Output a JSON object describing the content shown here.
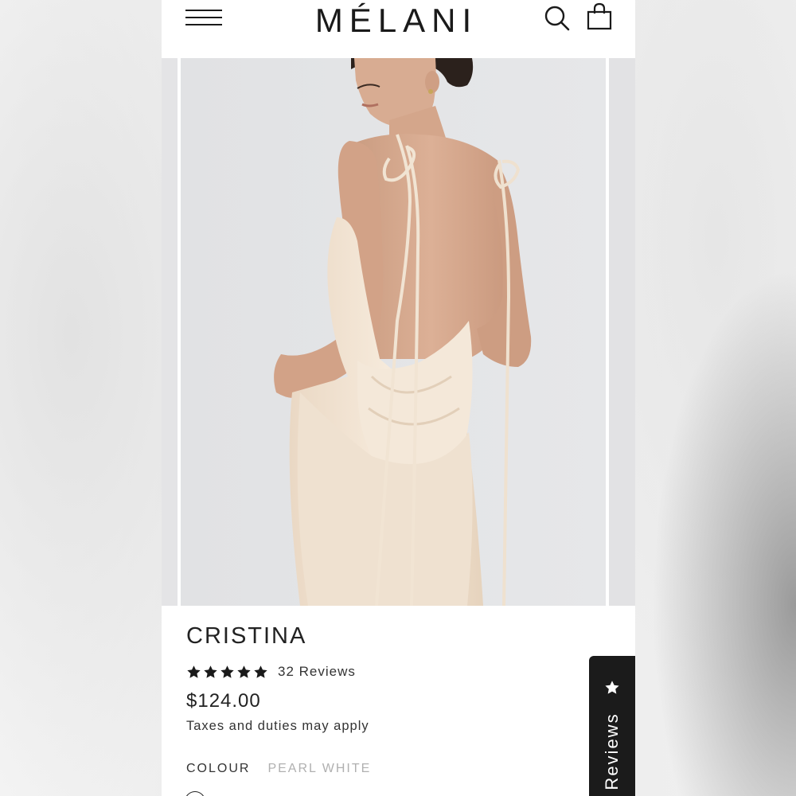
{
  "header": {
    "brand": "MÉLANI",
    "menu_icon": "hamburger-menu-icon",
    "search_icon": "search-icon",
    "bag_icon": "shopping-bag-icon"
  },
  "product": {
    "name": "CRISTINA",
    "rating": 5,
    "reviews_label": "32 Reviews",
    "price": "$124.00",
    "tax_note": "Taxes and duties may apply",
    "colour_label": "COLOUR",
    "colour_value": "PEARL WHITE"
  },
  "reviews_tab": {
    "label": "Reviews",
    "icon": "star-icon"
  },
  "colors": {
    "text": "#222222",
    "muted": "#b0b0b0",
    "tab_bg": "#1b1b1b",
    "dress": "#f3e6d6"
  }
}
